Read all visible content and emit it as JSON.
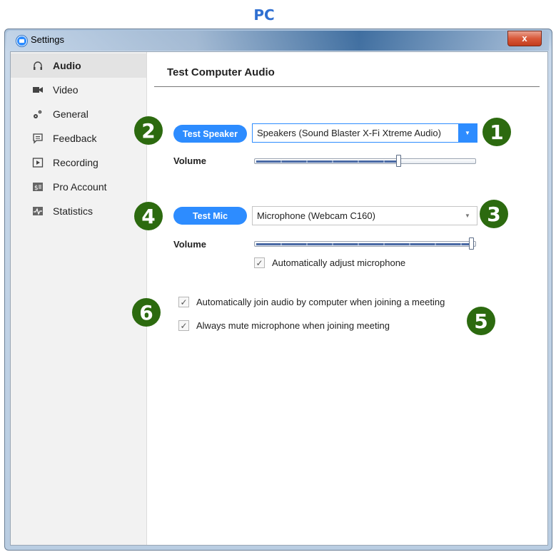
{
  "header_label": "PC",
  "window": {
    "title": "Settings",
    "close_label": "x"
  },
  "sidebar": {
    "items": [
      {
        "label": "Audio",
        "icon": "headphones-icon",
        "active": true
      },
      {
        "label": "Video",
        "icon": "video-camera-icon",
        "active": false
      },
      {
        "label": "General",
        "icon": "gears-icon",
        "active": false
      },
      {
        "label": "Feedback",
        "icon": "feedback-icon",
        "active": false
      },
      {
        "label": "Recording",
        "icon": "recording-icon",
        "active": false
      },
      {
        "label": "Pro Account",
        "icon": "pro-account-icon",
        "active": false
      },
      {
        "label": "Statistics",
        "icon": "statistics-icon",
        "active": false
      }
    ]
  },
  "main": {
    "title": "Test Computer Audio",
    "speaker": {
      "button_label": "Test Speaker",
      "device": "Speakers (Sound Blaster X-Fi Xtreme Audio)",
      "volume_label": "Volume",
      "volume_level": 0.66
    },
    "mic": {
      "button_label": "Test Mic",
      "device": "Microphone (Webcam C160)",
      "volume_label": "Volume",
      "volume_level": 1.0,
      "auto_adjust": {
        "label": "Automatically adjust microphone",
        "checked": true
      }
    },
    "options": [
      {
        "label": "Automatically join audio by computer when joining a meeting",
        "checked": true
      },
      {
        "label": "Always mute microphone when joining meeting",
        "checked": true
      }
    ]
  },
  "markers": [
    "1",
    "2",
    "3",
    "4",
    "5",
    "6"
  ],
  "colors": {
    "accent": "#2d8cff",
    "marker": "#2c6a0f",
    "header": "#2f6fd1"
  }
}
